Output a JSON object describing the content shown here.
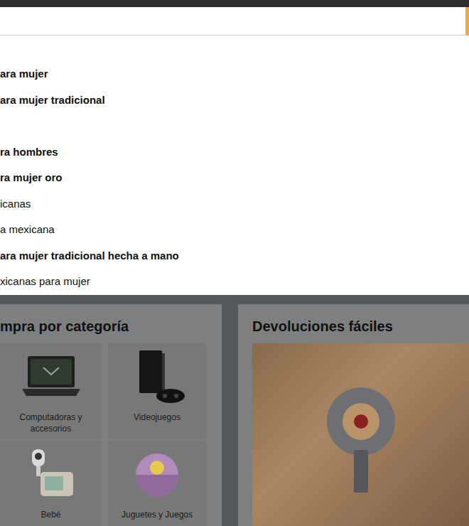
{
  "suggestions": [
    {
      "text": "ara mujer",
      "bold": true
    },
    {
      "text": "ara mujer tradicional",
      "bold": true
    },
    {
      "text": "ra hombres",
      "bold": true
    },
    {
      "text": "ra mujer oro",
      "bold": true
    },
    {
      "text": "icanas",
      "bold": false
    },
    {
      "text": "a mexicana",
      "bold": false
    },
    {
      "text": "ara mujer tradicional hecha a mano",
      "bold": true
    },
    {
      "text": "xicanas para mujer",
      "bold": false
    }
  ],
  "categories_card": {
    "title": "mpra por categoría",
    "items": [
      {
        "label": "Computadoras y accesorios",
        "kind": "computer"
      },
      {
        "label": "Videojuegos",
        "kind": "console"
      },
      {
        "label": "Bebé",
        "kind": "baby"
      },
      {
        "label": "Juguetes y Juegos",
        "kind": "toy"
      }
    ]
  },
  "returns_card": {
    "title": "Devoluciones fáciles"
  }
}
